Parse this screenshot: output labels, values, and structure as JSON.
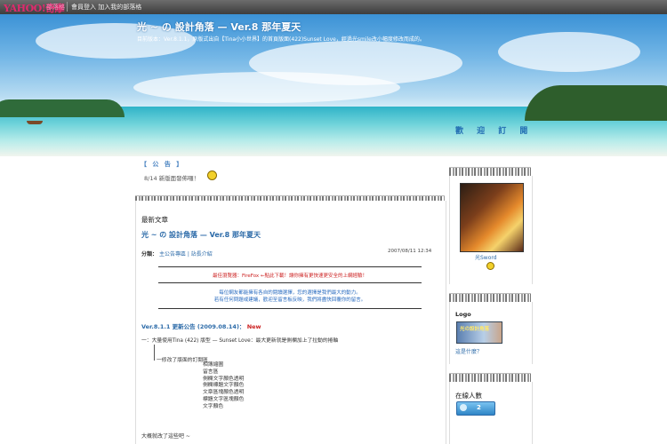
{
  "topbar": {
    "logo_text": "YAHOO!奇摩",
    "logo_sub": "部落格",
    "links": "會員登入  加入我的部落格"
  },
  "header": {
    "title": "光 ~ の 設計角落 — Ver.8 那年夏天",
    "subtitle": "目前版本：Ver.8.1.1，原版式出自【Tina小小世界】的首頁版面(422)Sunset Love，經過光smile改小幅度修改而成的。"
  },
  "welcome": "歡 迎 訂 閱",
  "notice": {
    "title": "【 公 告 】",
    "text": "8/14 新版面發佈囉！"
  },
  "post": {
    "category_label": "最新文章",
    "title": "光 ~ の 設計角落 — Ver.8 那年夏天",
    "meta_label": "分類：",
    "meta_links": "主公告專區 | 站長介紹",
    "date": "2007/08/11 12:34",
    "red_notice": "最佳瀏覽器：FireFox ←點此下載！讓你擁有更快速更安全的上網經驗！",
    "blue_notice_1": "每位網友都能擁有各自的閱讀選擇，您的選擇是我們最大的動力。",
    "blue_notice_2": "若有任何問題或建議，歡迎至留言板反映，我們將盡快回覆你的留言。",
    "update_head": "Ver.8.1.1 更新公告 (2009.08.14)：",
    "update_new": "New",
    "update_line": "一：大量使用Tina (422) 版型 — Sunset Love：最大更新就是側欄加上了拉動的捲軸",
    "indent1": "一修改了版面的訂閱區",
    "indent2": [
      "相簿縮圖",
      "留言區",
      "側欄文字顏色透明",
      "側欄標題文字顏色",
      "文章區塊顏色透明",
      "標題文字區塊顏色",
      "文字顏色"
    ],
    "bottom_text": "大概就改了這些吧 ~"
  },
  "sidebar": {
    "avatar_name": "光Sword",
    "logo_title": "Logo",
    "logo_img_text": "光の設計角落",
    "logo_link": "這是什麼？",
    "online_title": "在線人數",
    "online_count": "2"
  }
}
